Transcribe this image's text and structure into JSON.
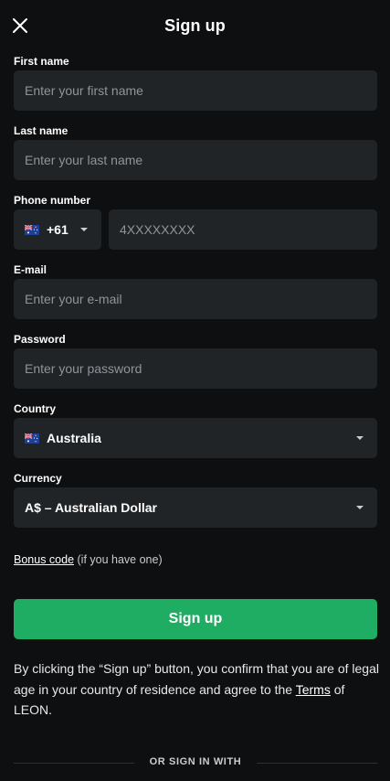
{
  "header": {
    "title": "Sign up",
    "close_icon": "close-icon"
  },
  "form": {
    "first_name": {
      "label": "First name",
      "placeholder": "Enter your first name"
    },
    "last_name": {
      "label": "Last name",
      "placeholder": "Enter your last name"
    },
    "phone": {
      "label": "Phone number",
      "country_code": "+61",
      "flag_icon": "australia-flag-icon",
      "placeholder": "4XXXXXXXX"
    },
    "email": {
      "label": "E-mail",
      "placeholder": "Enter your e-mail"
    },
    "password": {
      "label": "Password",
      "placeholder": "Enter your password"
    },
    "country": {
      "label": "Country",
      "value": "Australia",
      "flag_icon": "australia-flag-icon"
    },
    "currency": {
      "label": "Currency",
      "value": "A$ – Australian Dollar"
    }
  },
  "bonus": {
    "link": "Bonus code",
    "note": "(if you have one)"
  },
  "submit": {
    "label": "Sign up",
    "color": "#1fad63"
  },
  "legal": {
    "text_before": "By clicking the “Sign up” button, you confirm that you are of legal age in your country of residence and agree to the ",
    "terms_link": "Terms",
    "text_after": " of LEON."
  },
  "divider": {
    "text": "OR SIGN IN WITH"
  },
  "colors": {
    "background": "#0e0f11",
    "field": "#212427",
    "accent": "#1fad63"
  }
}
